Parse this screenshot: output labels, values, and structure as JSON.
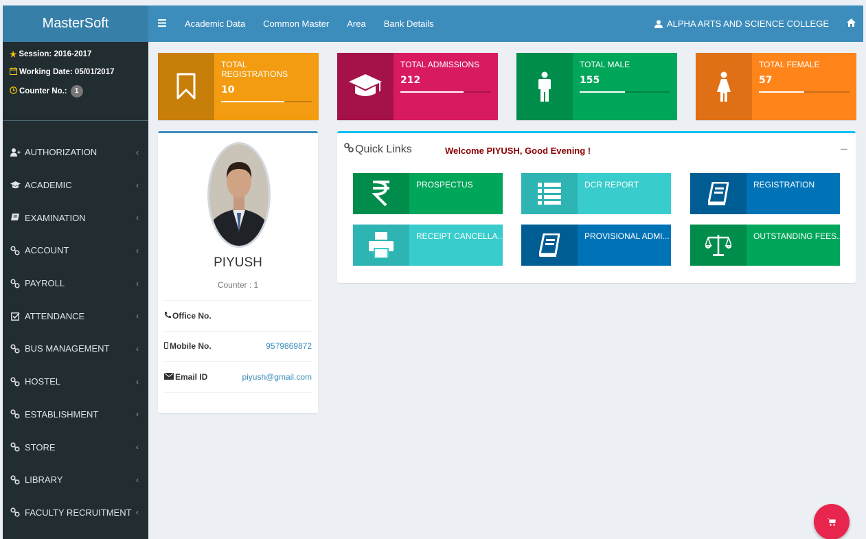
{
  "brand": {
    "title": "MasterSoft"
  },
  "topbar": {
    "nav": [
      "Academic Data",
      "Common Master",
      "Area",
      "Bank Details"
    ],
    "college": "ALPHA ARTS AND SCIENCE COLLEGE"
  },
  "sidebar": {
    "session": "Session: 2016-2017",
    "working_date": "Working Date: 05/01/2017",
    "counter_label": "Counter No.:",
    "counter_value": "1",
    "menu": [
      {
        "label": "AUTHORIZATION",
        "icon": "user-plus-icon"
      },
      {
        "label": "ACADEMIC",
        "icon": "graduation-cap-icon"
      },
      {
        "label": "EXAMINATION",
        "icon": "book-icon"
      },
      {
        "label": "ACCOUNT",
        "icon": "link-icon"
      },
      {
        "label": "PAYROLL",
        "icon": "link-icon"
      },
      {
        "label": "ATTENDANCE",
        "icon": "check-square-icon"
      },
      {
        "label": "BUS MANAGEMENT",
        "icon": "link-icon"
      },
      {
        "label": "HOSTEL",
        "icon": "link-icon"
      },
      {
        "label": "ESTABLISHMENT",
        "icon": "link-icon"
      },
      {
        "label": "STORE",
        "icon": "link-icon"
      },
      {
        "label": "LIBRARY",
        "icon": "link-icon"
      },
      {
        "label": "FACULTY RECRUITMENT",
        "icon": "link-icon"
      }
    ]
  },
  "stats": [
    {
      "label": "TOTAL REGISTRATIONS",
      "value": "10",
      "icon": "bookmark-icon",
      "color": "#f39c12",
      "dark": "#c87f0a",
      "progress": 0.7
    },
    {
      "label": "TOTAL ADMISSIONS",
      "value": "212",
      "icon": "graduation-cap-icon",
      "color": "#d81b60",
      "dark": "#a41249",
      "progress": 0.7
    },
    {
      "label": "TOTAL MALE",
      "value": "155",
      "icon": "male-icon",
      "color": "#00a65a",
      "dark": "#008d4c",
      "progress": 0.5
    },
    {
      "label": "TOTAL FEMALE",
      "value": "57",
      "icon": "female-icon",
      "color": "#ff851b",
      "dark": "#e07016",
      "progress": 0.5
    }
  ],
  "profile": {
    "name": "PIYUSH",
    "counter": "Counter : 1",
    "office_label": "Office No.",
    "office_value": "",
    "mobile_label": "Mobile No.",
    "mobile_value": "9579869872",
    "email_label": "Email ID",
    "email_value": "piyush@gmail.com"
  },
  "quick_links": {
    "title": "Quick Links",
    "welcome": "Welcome PIYUSH, Good Evening !",
    "items": [
      {
        "label": "PROSPECTUS",
        "icon": "rupee-icon",
        "color": "#00a65a",
        "dark": "#008d4c"
      },
      {
        "label": "DCR REPORT",
        "icon": "list-icon",
        "color": "#39cccc",
        "dark": "#2fb4b4"
      },
      {
        "label": "REGISTRATION",
        "icon": "book-icon",
        "color": "#0073b7",
        "dark": "#005d94"
      },
      {
        "label": "RECEIPT CANCELLA...",
        "icon": "print-icon",
        "color": "#39cccc",
        "dark": "#2fb4b4"
      },
      {
        "label": "PROVISIONAL ADMI...",
        "icon": "book-icon",
        "color": "#0073b7",
        "dark": "#005d94"
      },
      {
        "label": "OUTSTANDING FEES...",
        "icon": "balance-scale-icon",
        "color": "#00a65a",
        "dark": "#008d4c"
      }
    ]
  }
}
